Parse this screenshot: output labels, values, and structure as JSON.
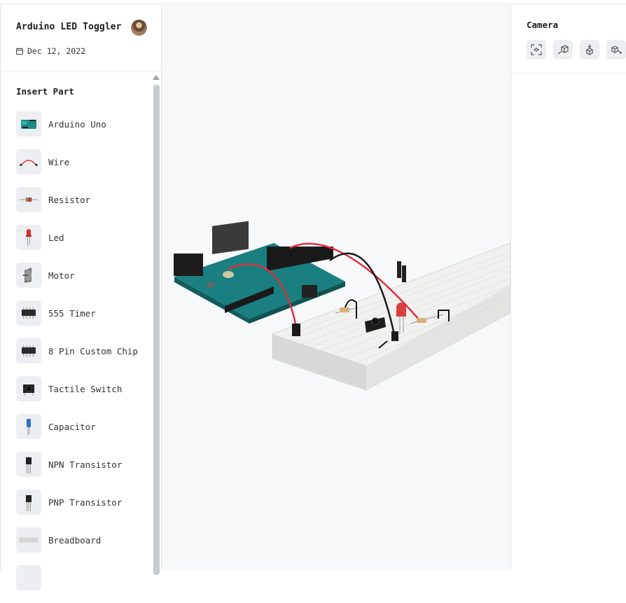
{
  "project": {
    "title": "Arduino LED Toggler",
    "date": "Dec 12, 2022"
  },
  "sidebar": {
    "section_title": "Insert Part",
    "parts": [
      {
        "label": "Arduino Uno",
        "icon": "arduino-uno-icon"
      },
      {
        "label": "Wire",
        "icon": "wire-icon"
      },
      {
        "label": "Resistor",
        "icon": "resistor-icon"
      },
      {
        "label": "Led",
        "icon": "led-icon"
      },
      {
        "label": "Motor",
        "icon": "motor-icon"
      },
      {
        "label": "555 Timer",
        "icon": "ic-chip-icon"
      },
      {
        "label": "8 Pin Custom Chip",
        "icon": "ic-chip-icon"
      },
      {
        "label": "Tactile Switch",
        "icon": "tactile-switch-icon"
      },
      {
        "label": "Capacitor",
        "icon": "capacitor-icon"
      },
      {
        "label": "NPN Transistor",
        "icon": "transistor-icon"
      },
      {
        "label": "PNP Transistor",
        "icon": "transistor-icon"
      },
      {
        "label": "Breadboard",
        "icon": "breadboard-icon"
      }
    ]
  },
  "camera": {
    "title": "Camera",
    "buttons": [
      "camera-fit-icon",
      "camera-iso-icon",
      "camera-top-icon",
      "camera-side-icon"
    ]
  },
  "colors": {
    "board_teal": "#1e8a8a",
    "wire_red": "#e0303f",
    "led_red": "#d62b2b",
    "breadboard": "#efefee"
  }
}
